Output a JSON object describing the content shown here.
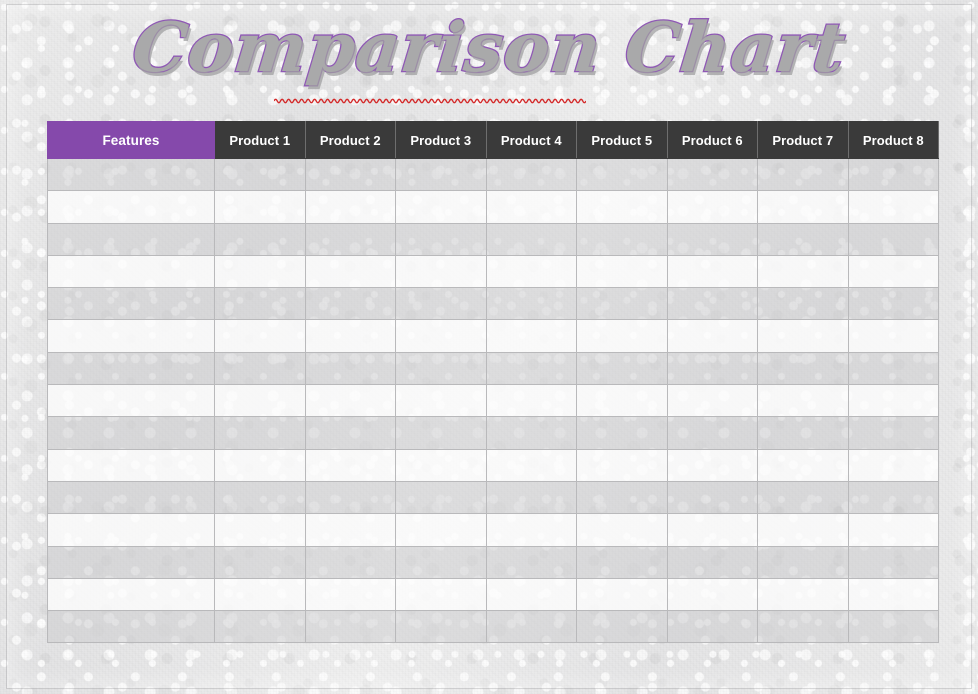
{
  "document": {
    "title": "Comparison Chart",
    "title_underline_style": "red-wavy-spellcheck"
  },
  "colors": {
    "features_header_bg": "#8549ab",
    "product_header_bg": "#3a3a3a",
    "header_text": "#ffffff",
    "row_odd_bg": "#cbcbce",
    "row_even_bg": "#fcfcfd",
    "grid_line": "#b9b9bb",
    "title_fill": "#a9a9aa",
    "title_outline": "#8f58b5",
    "underline_red": "#d42a2a",
    "page_bg": "#e8e8e9"
  },
  "table": {
    "columns": [
      {
        "key": "features",
        "label": "Features",
        "type": "header-accent"
      },
      {
        "key": "product_1",
        "label": "Product 1",
        "type": "header-dark"
      },
      {
        "key": "product_2",
        "label": "Product 2",
        "type": "header-dark"
      },
      {
        "key": "product_3",
        "label": "Product 3",
        "type": "header-dark"
      },
      {
        "key": "product_4",
        "label": "Product 4",
        "type": "header-dark"
      },
      {
        "key": "product_5",
        "label": "Product 5",
        "type": "header-dark"
      },
      {
        "key": "product_6",
        "label": "Product 6",
        "type": "header-dark"
      },
      {
        "key": "product_7",
        "label": "Product 7",
        "type": "header-dark"
      },
      {
        "key": "product_8",
        "label": "Product 8",
        "type": "header-dark"
      }
    ],
    "row_count": 15,
    "rows": [
      {
        "features": "",
        "product_1": "",
        "product_2": "",
        "product_3": "",
        "product_4": "",
        "product_5": "",
        "product_6": "",
        "product_7": "",
        "product_8": ""
      },
      {
        "features": "",
        "product_1": "",
        "product_2": "",
        "product_3": "",
        "product_4": "",
        "product_5": "",
        "product_6": "",
        "product_7": "",
        "product_8": ""
      },
      {
        "features": "",
        "product_1": "",
        "product_2": "",
        "product_3": "",
        "product_4": "",
        "product_5": "",
        "product_6": "",
        "product_7": "",
        "product_8": ""
      },
      {
        "features": "",
        "product_1": "",
        "product_2": "",
        "product_3": "",
        "product_4": "",
        "product_5": "",
        "product_6": "",
        "product_7": "",
        "product_8": ""
      },
      {
        "features": "",
        "product_1": "",
        "product_2": "",
        "product_3": "",
        "product_4": "",
        "product_5": "",
        "product_6": "",
        "product_7": "",
        "product_8": ""
      },
      {
        "features": "",
        "product_1": "",
        "product_2": "",
        "product_3": "",
        "product_4": "",
        "product_5": "",
        "product_6": "",
        "product_7": "",
        "product_8": ""
      },
      {
        "features": "",
        "product_1": "",
        "product_2": "",
        "product_3": "",
        "product_4": "",
        "product_5": "",
        "product_6": "",
        "product_7": "",
        "product_8": ""
      },
      {
        "features": "",
        "product_1": "",
        "product_2": "",
        "product_3": "",
        "product_4": "",
        "product_5": "",
        "product_6": "",
        "product_7": "",
        "product_8": ""
      },
      {
        "features": "",
        "product_1": "",
        "product_2": "",
        "product_3": "",
        "product_4": "",
        "product_5": "",
        "product_6": "",
        "product_7": "",
        "product_8": ""
      },
      {
        "features": "",
        "product_1": "",
        "product_2": "",
        "product_3": "",
        "product_4": "",
        "product_5": "",
        "product_6": "",
        "product_7": "",
        "product_8": ""
      },
      {
        "features": "",
        "product_1": "",
        "product_2": "",
        "product_3": "",
        "product_4": "",
        "product_5": "",
        "product_6": "",
        "product_7": "",
        "product_8": ""
      },
      {
        "features": "",
        "product_1": "",
        "product_2": "",
        "product_3": "",
        "product_4": "",
        "product_5": "",
        "product_6": "",
        "product_7": "",
        "product_8": ""
      },
      {
        "features": "",
        "product_1": "",
        "product_2": "",
        "product_3": "",
        "product_4": "",
        "product_5": "",
        "product_6": "",
        "product_7": "",
        "product_8": ""
      },
      {
        "features": "",
        "product_1": "",
        "product_2": "",
        "product_3": "",
        "product_4": "",
        "product_5": "",
        "product_6": "",
        "product_7": "",
        "product_8": ""
      },
      {
        "features": "",
        "product_1": "",
        "product_2": "",
        "product_3": "",
        "product_4": "",
        "product_5": "",
        "product_6": "",
        "product_7": "",
        "product_8": ""
      }
    ]
  }
}
